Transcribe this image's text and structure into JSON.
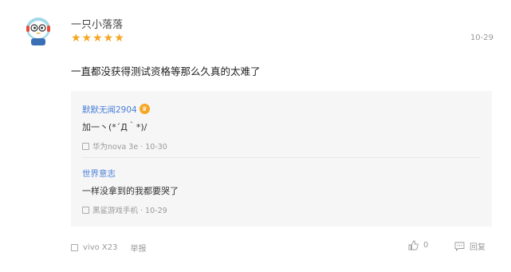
{
  "review": {
    "username": "一只小落落",
    "stars": "★★★★★",
    "date": "10-29",
    "comment": "一直都没获得测试资格等那么久真的太难了"
  },
  "replies": [
    {
      "name": "默默无闻2904",
      "badge": "♛",
      "text": "加一丶(*´Д｀*)/",
      "meta": "华为nova 3e · 10-30"
    },
    {
      "name": "世界意志",
      "text": "一样没拿到的我都要哭了",
      "meta": "黑鲨游戏手机 · 10-29"
    }
  ],
  "footer": {
    "device": "vivo X23",
    "report": "举报",
    "like_count": "0",
    "reply": "回复"
  }
}
